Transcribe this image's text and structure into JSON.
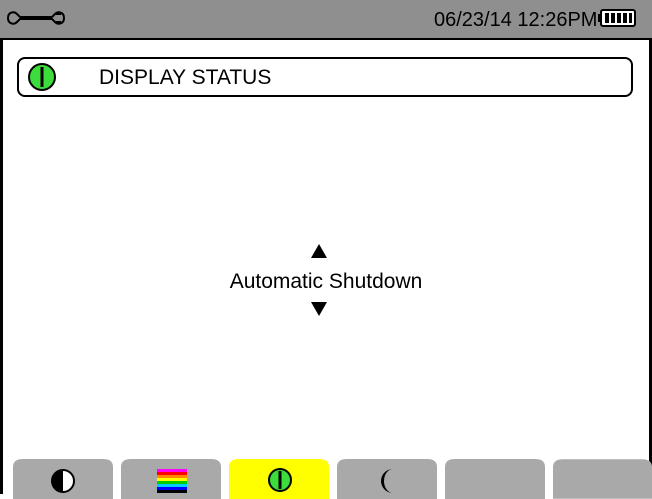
{
  "status_bar": {
    "wrench_icon": "wrench-icon",
    "datetime": "06/23/14  12:26PM",
    "battery_icon": "battery-full-icon"
  },
  "title_bar": {
    "icon": "power-icon",
    "title": "DISPLAY STATUS"
  },
  "setting": {
    "label": "Automatic Shutdown",
    "up_icon": "arrow-up-icon",
    "down_icon": "arrow-down-icon"
  },
  "tabs": [
    {
      "name": "contrast",
      "icon": "contrast-icon",
      "selected": false
    },
    {
      "name": "colors",
      "icon": "color-bars-icon",
      "selected": false
    },
    {
      "name": "display-status",
      "icon": "power-icon",
      "selected": true
    },
    {
      "name": "night-mode",
      "icon": "moon-icon",
      "selected": false
    },
    {
      "name": "empty-5",
      "icon": "",
      "selected": false
    },
    {
      "name": "empty-6",
      "icon": "",
      "selected": false
    }
  ],
  "colors": {
    "status_bar": "#8f8f8f",
    "tab_default": "#a9a9a9",
    "tab_selected": "#ffff00",
    "power_green": "#3ddc3d"
  }
}
